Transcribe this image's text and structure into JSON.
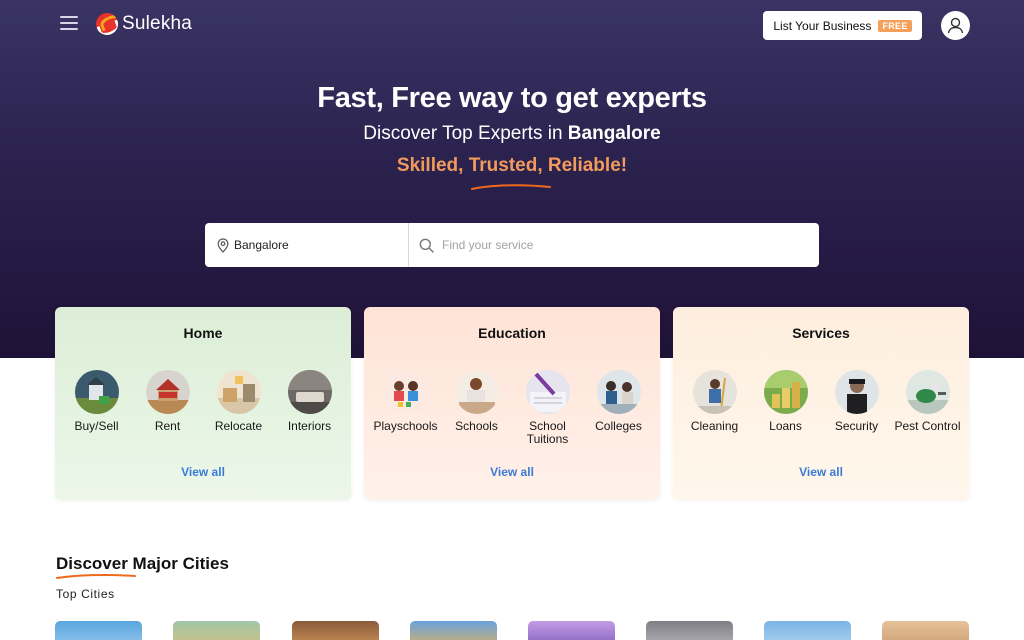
{
  "header": {
    "logo_text": "Sulekha",
    "list_business_label": "List Your Business",
    "free_badge": "FREE",
    "menu_icon": "hamburger-menu-icon",
    "profile_icon": "user-icon"
  },
  "hero": {
    "headline": "Fast, Free way to get experts",
    "subline_prefix": "Discover Top Experts in",
    "city": "Bangalore",
    "tagline": "Skilled, Trusted, Reliable!"
  },
  "search": {
    "location_value": "Bangalore",
    "service_placeholder": "Find your service",
    "location_icon": "map-pin-icon",
    "search_icon": "search-icon"
  },
  "categories": [
    {
      "title": "Home",
      "view_all": "View all",
      "items": [
        {
          "label": "Buy/Sell"
        },
        {
          "label": "Rent"
        },
        {
          "label": "Relocate"
        },
        {
          "label": "Interiors"
        }
      ]
    },
    {
      "title": "Education",
      "view_all": "View all",
      "items": [
        {
          "label": "Playschools"
        },
        {
          "label": "Schools"
        },
        {
          "label": "School Tuitions"
        },
        {
          "label": "Colleges"
        }
      ]
    },
    {
      "title": "Services",
      "view_all": "View all",
      "items": [
        {
          "label": "Cleaning"
        },
        {
          "label": "Loans"
        },
        {
          "label": "Security"
        },
        {
          "label": "Pest Control"
        }
      ]
    }
  ],
  "cities_section": {
    "title": "Discover Major Cities",
    "subtitle": "Top Cities"
  },
  "colors": {
    "hero_top": "#3a3464",
    "hero_bottom": "#1f1238",
    "accent_orange": "#f19a5c",
    "link_blue": "#3b7ad8",
    "home_card": "#dceed6",
    "education_card": "#ffe3d6",
    "services_card": "#feeede"
  }
}
